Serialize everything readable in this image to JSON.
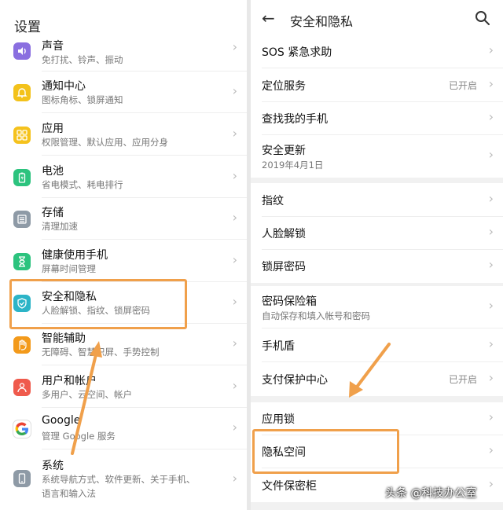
{
  "left": {
    "title": "设置",
    "items": [
      {
        "label": "声音",
        "sub": "免打扰、铃声、振动",
        "icon": "sound-icon",
        "color": "#8a6fe0"
      },
      {
        "label": "通知中心",
        "sub": "图标角标、锁屏通知",
        "icon": "bell-icon",
        "color": "#f3c21b"
      },
      {
        "label": "应用",
        "sub": "权限管理、默认应用、应用分身",
        "icon": "apps-grid-icon",
        "color": "#f5c21d"
      },
      {
        "label": "电池",
        "sub": "省电模式、耗电排行",
        "icon": "battery-icon",
        "color": "#2cc37e"
      },
      {
        "label": "存储",
        "sub": "清理加速",
        "icon": "storage-icon",
        "color": "#8e9aa6"
      },
      {
        "label": "健康使用手机",
        "sub": "屏幕时间管理",
        "icon": "hourglass-icon",
        "color": "#2cc37e"
      },
      {
        "label": "安全和隐私",
        "sub": "人脸解锁、指纹、锁屏密码",
        "icon": "shield-icon",
        "color": "#2cb4c7"
      },
      {
        "label": "智能辅助",
        "sub": "无障碍、智慧识屏、手势控制",
        "icon": "hand-icon",
        "color": "#f39a1b"
      },
      {
        "label": "用户和帐户",
        "sub": "多用户、云空间、帐户",
        "icon": "user-icon",
        "color": "#ef5a4c"
      },
      {
        "label": "Google",
        "sub": "管理 Google 服务",
        "icon": "google-icon",
        "color": "#ffffff"
      },
      {
        "label": "系统",
        "sub": "系统导航方式、软件更新、关于手机、",
        "sub2": "语言和输入法",
        "icon": "phone-system-icon",
        "color": "#8e9aa6"
      }
    ]
  },
  "right": {
    "title": "安全和隐私",
    "groups": [
      [
        {
          "label": "SOS 紧急求助"
        },
        {
          "label": "定位服务",
          "status": "已开启"
        },
        {
          "label": "查找我的手机"
        },
        {
          "label": "安全更新",
          "sub": "2019年4月1日"
        }
      ],
      [
        {
          "label": "指纹"
        },
        {
          "label": "人脸解锁"
        },
        {
          "label": "锁屏密码"
        }
      ],
      [
        {
          "label": "密码保险箱",
          "sub": "自动保存和填入帐号和密码"
        },
        {
          "label": "手机盾"
        },
        {
          "label": "支付保护中心",
          "status": "已开启"
        }
      ],
      [
        {
          "label": "应用锁"
        },
        {
          "label": "隐私空间"
        },
        {
          "label": "文件保密柜"
        }
      ]
    ]
  },
  "watermark": "头条 @科技办公室",
  "colors": {
    "highlight": "#f0a04b",
    "text": "#111111",
    "subtext": "#777777"
  }
}
